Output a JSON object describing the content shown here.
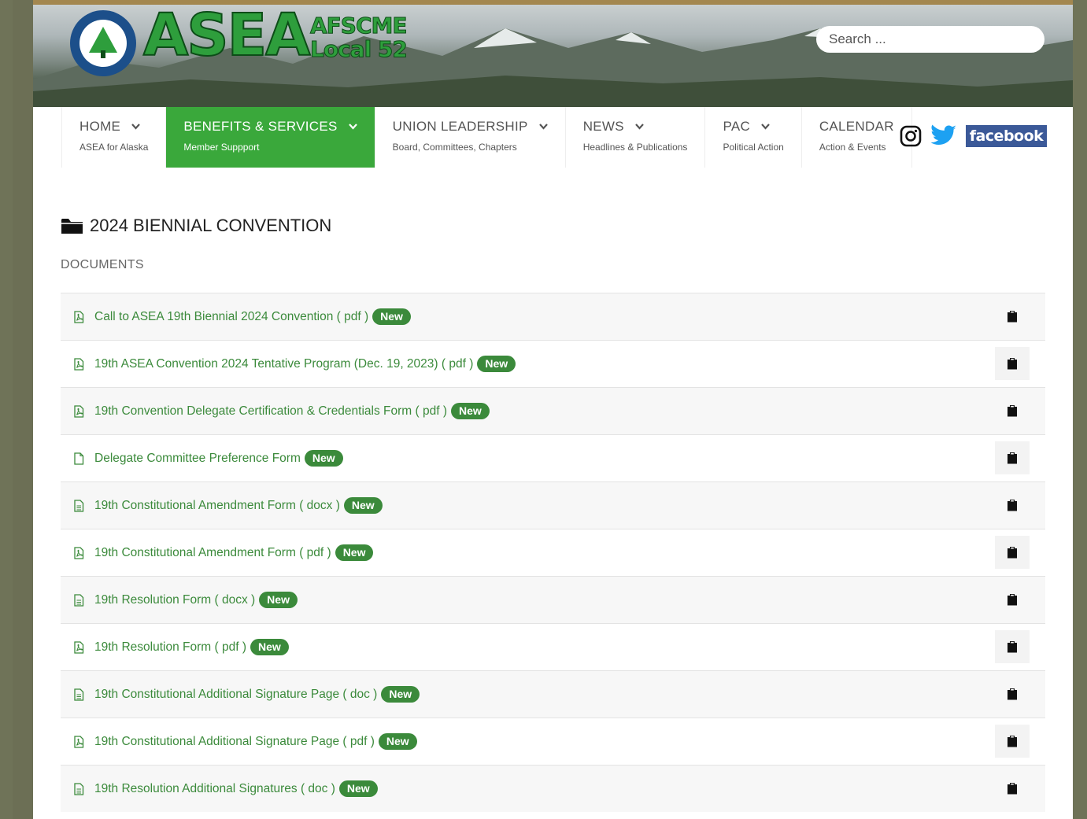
{
  "header": {
    "logo_word": "ASEA",
    "logo_sub_1": "AFSCME",
    "logo_sub_2": "Local 52",
    "seal_text": "ASEA/AFSCME Local 52 · Alaskans Working for Alaska",
    "search_placeholder": "Search ..."
  },
  "nav": {
    "items": [
      {
        "title": "HOME",
        "sub": "ASEA for Alaska"
      },
      {
        "title": "BENEFITS & SERVICES",
        "sub": "Member Suppport"
      },
      {
        "title": "UNION LEADERSHIP",
        "sub": "Board, Committees, Chapters"
      },
      {
        "title": "NEWS",
        "sub": "Headlines & Publications"
      },
      {
        "title": "PAC",
        "sub": "Political Action"
      },
      {
        "title": "CALENDAR",
        "sub": "Action & Events"
      }
    ],
    "active_index": 1,
    "active_color": "#3aa83b"
  },
  "social": {
    "icons": [
      "instagram-icon",
      "twitter-icon",
      "facebook-icon"
    ],
    "facebook_label": "facebook"
  },
  "category": {
    "title": "2024 BIENNIAL CONVENTION",
    "icon": "folder-icon",
    "section_label": "DOCUMENTS"
  },
  "documents": [
    {
      "title": "Call to ASEA 19th Biennial 2024 Convention",
      "ext": " ( pdf )",
      "badge": "New",
      "icon": "pdf-file-icon"
    },
    {
      "title": "19th ASEA Convention 2024 Tentative Program (Dec. 19, 2023)",
      "ext": " ( pdf )",
      "badge": "New",
      "icon": "pdf-file-icon"
    },
    {
      "title": "19th Convention Delegate Certification & Credentials Form",
      "ext": " ( pdf )",
      "badge": "New",
      "icon": "pdf-file-icon"
    },
    {
      "title": "Delegate Committee Preference Form",
      "ext": "",
      "badge": "New",
      "icon": "blank-file-icon"
    },
    {
      "title": "19th Constitutional Amendment Form",
      "ext": " ( docx )",
      "badge": "New",
      "icon": "word-file-icon"
    },
    {
      "title": "19th Constitutional Amendment Form",
      "ext": " ( pdf )",
      "badge": "New",
      "icon": "pdf-file-icon"
    },
    {
      "title": "19th Resolution Form",
      "ext": " ( docx )",
      "badge": "New",
      "icon": "word-file-icon"
    },
    {
      "title": "19th Resolution Form",
      "ext": " ( pdf )",
      "badge": "New",
      "icon": "pdf-file-icon"
    },
    {
      "title": "19th Constitutional Additional Signature Page",
      "ext": " ( doc )",
      "badge": "New",
      "icon": "word-file-icon"
    },
    {
      "title": "19th Constitutional Additional Signature Page",
      "ext": " ( pdf )",
      "badge": "New",
      "icon": "pdf-file-icon"
    },
    {
      "title": "19th Resolution Additional Signatures",
      "ext": " ( doc )",
      "badge": "New",
      "icon": "word-file-icon"
    }
  ],
  "colors": {
    "link": "#3b8a3b",
    "badge": "#3b8a3b",
    "frame": "#a3874f"
  }
}
